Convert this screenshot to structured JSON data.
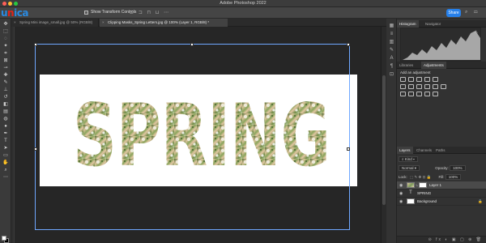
{
  "app": {
    "title": "Adobe Photoshop 2022"
  },
  "brand": {
    "logo": "unica"
  },
  "options_bar": {
    "show_transform_label": "Show Transform Controls",
    "share_label": "Share"
  },
  "tabs": [
    {
      "label": "Spring Mini image_small.jpg @ 50% (RGB/8)",
      "close": "×"
    },
    {
      "label": "Clipping Masks_Spring Letters.jpg @ 100% (Layer 1, RGB/8) *",
      "close": "×"
    }
  ],
  "canvas": {
    "word": "SPRING",
    "background": "#ffffff",
    "letter_fill": "photo of a girl among blossoms"
  },
  "panels": {
    "histogram_tab": "Histogram",
    "navigator_tab": "Navigator",
    "libraries_tab": "Libraries",
    "adjustments_tab": "Adjustments",
    "adjustments_title": "Add an adjustment",
    "layers_tab": "Layers",
    "channels_tab": "Channels",
    "paths_tab": "Paths"
  },
  "layers": {
    "kind": "Kind",
    "blend_mode": "Normal",
    "opacity_label": "Opacity:",
    "opacity_value": "100%",
    "lock_label": "Lock:",
    "fill_label": "Fill:",
    "fill_value": "100%",
    "items": [
      {
        "name": "Layer 1",
        "selected": true
      },
      {
        "name": "SPRING",
        "selected": false
      },
      {
        "name": "Background",
        "selected": false,
        "locked": true
      }
    ]
  },
  "colors": {
    "accent": "#2680eb",
    "foreground": "#ffffff",
    "background": "#000000",
    "transform_box": "#6fa8ff"
  }
}
